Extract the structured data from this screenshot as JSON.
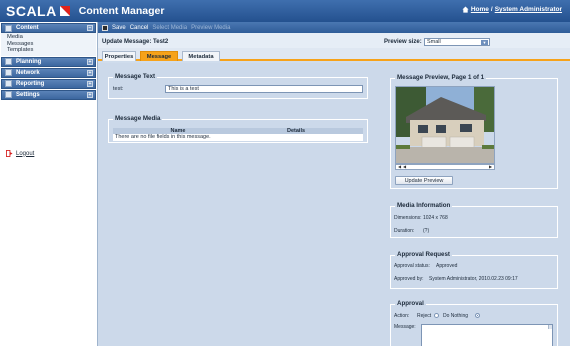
{
  "app": {
    "logo_text": "SCALA",
    "title": "Content Manager",
    "top_links": {
      "home": "Home",
      "separator": "/",
      "user": "System Administrator"
    }
  },
  "sidebar": {
    "sections": [
      {
        "label": "Content",
        "toggle": "−",
        "items": [
          "Media",
          "Messages",
          "Templates"
        ]
      },
      {
        "label": "Planning",
        "toggle": "+"
      },
      {
        "label": "Network",
        "toggle": "+"
      },
      {
        "label": "Reporting",
        "toggle": "+"
      },
      {
        "label": "Settings",
        "toggle": "+"
      }
    ],
    "logout": "Logout"
  },
  "toolbar": {
    "save": "Save",
    "cancel": "Cancel",
    "select_media": "Select Media",
    "preview_media": "Preview Media"
  },
  "header": {
    "title": "Update Message: Test2",
    "preview_size_label": "Preview size:",
    "preview_size_value": "Small"
  },
  "tabs": [
    "Properties",
    "Message",
    "Metadata"
  ],
  "message_text": {
    "title": "Message Text",
    "field_label": "test:",
    "field_value": "This is a test"
  },
  "message_media": {
    "title": "Message Media",
    "columns": [
      "Name",
      "Details"
    ],
    "empty_text": "There are no file fields in this message."
  },
  "preview": {
    "title": "Message Preview, Page 1 of 1",
    "update_button": "Update Preview"
  },
  "media_info": {
    "title": "Media Information",
    "dimensions_label": "Dimensions:",
    "dimensions_value": "1024 x 768",
    "duration_label": "Duration:",
    "duration_value": "(?)"
  },
  "approval_request": {
    "title": "Approval Request",
    "status_label": "Approval status:",
    "status_value": "Approved",
    "by_label": "Approved by:",
    "by_value": "System Administrator, 2010.02.23 09:17"
  },
  "approval": {
    "title": "Approval",
    "action_label": "Action:",
    "reject": "Reject",
    "do_nothing": "Do Nothing",
    "message_label": "Message:"
  },
  "colors": {
    "header": "#2f5c98",
    "active_tab": "#f6a21a",
    "background": "#ccd9ea"
  }
}
